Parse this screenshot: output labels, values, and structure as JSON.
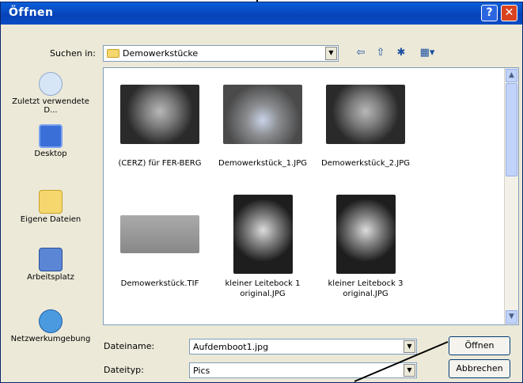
{
  "window": {
    "title": "Öffnen",
    "help_label": "?",
    "close_label": "✕"
  },
  "lookin": {
    "label": "Suchen in:",
    "value": "Demowerkstücke",
    "dropdown": "▼"
  },
  "toolbar": {
    "back": "⇦",
    "up": "⇧",
    "newfolder": "✱",
    "views": "▦▾"
  },
  "places": [
    {
      "label": "Zuletzt verwendete D...",
      "icon": "recent-documents-icon",
      "color": "#d7e6f7"
    },
    {
      "label": "Desktop",
      "icon": "desktop-icon",
      "color": "#3b6fd8"
    },
    {
      "label": "Eigene Dateien",
      "icon": "my-documents-icon",
      "color": "#f5d76e"
    },
    {
      "label": "Arbeitsplatz",
      "icon": "my-computer-icon",
      "color": "#5b86d6"
    },
    {
      "label": "Netzwerkumgebung",
      "icon": "network-places-icon",
      "color": "#4b9ae0"
    }
  ],
  "files": [
    {
      "name": "(CERZ) für FER-BERG",
      "photo": "dark"
    },
    {
      "name": "Demowerkstück_1.JPG",
      "photo": "mid"
    },
    {
      "name": "Demowerkstück_2.JPG",
      "photo": "dark"
    },
    {
      "name": "Demowerkstück.TIF",
      "photo": "grey"
    },
    {
      "name": "kleiner Leitebock 1 original.JPG",
      "photo": "dark2"
    },
    {
      "name": "kleiner Leitebock 3 original.JPG",
      "photo": "dark2"
    }
  ],
  "scroll": {
    "up": "▲",
    "down": "▼"
  },
  "filename": {
    "label": "Dateiname:",
    "value": "Aufdemboot1.jpg",
    "dropdown": "▼"
  },
  "filetype": {
    "label": "Dateityp:",
    "value": "Pics",
    "dropdown": "▼"
  },
  "buttons": {
    "open": "Öffnen",
    "cancel": "Abbrechen"
  }
}
